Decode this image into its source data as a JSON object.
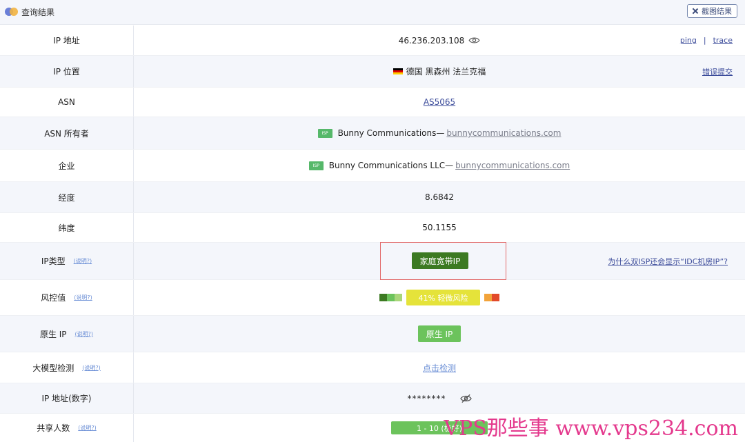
{
  "header": {
    "title": "查询结果",
    "screenshot_button": "截图结果"
  },
  "rows": {
    "ip_address": {
      "label": "IP 地址",
      "value": "46.236.203.108",
      "ping": "ping",
      "separator": "|",
      "trace": "trace"
    },
    "ip_location": {
      "label": "IP 位置",
      "value": "德国 黑森州 法兰克福",
      "flag": "germany-flag",
      "report": "错误提交"
    },
    "asn": {
      "label": "ASN",
      "value": "AS5065"
    },
    "asn_owner": {
      "label": "ASN 所有者",
      "badge": "ISP",
      "name": "Bunny Communications—",
      "domain": "bunnycommunications.com"
    },
    "company": {
      "label": "企业",
      "badge": "ISP",
      "name": "Bunny Communications LLC—",
      "domain": "bunnycommunications.com"
    },
    "longitude": {
      "label": "经度",
      "value": "8.6842"
    },
    "latitude": {
      "label": "纬度",
      "value": "50.1155"
    },
    "ip_type": {
      "label": "IP类型",
      "help": "(说明?)",
      "value": "家庭宽带IP",
      "right_link": "为什么双ISP还会显示“IDC机房IP”?"
    },
    "risk": {
      "label": "风控值",
      "help": "(说明?)",
      "value": "41%  轻微风险",
      "colors": [
        "#3c7a22",
        "#6cc35c",
        "#a9d67a",
        "#e5e33a",
        "#f2a33a",
        "#e24a2a"
      ]
    },
    "native_ip": {
      "label": "原生 IP",
      "help": "(说明?)",
      "value": "原生 IP"
    },
    "llm_check": {
      "label": "大模型检测",
      "help": "(说明?)",
      "value": "点击检测"
    },
    "ip_numeric": {
      "label": "IP 地址(数字)",
      "value": "********"
    },
    "share_count": {
      "label": "共享人数",
      "help": "(说明?)",
      "value": "1 - 10 (极好)"
    }
  },
  "watermark": "VPS那些事 www.vps234.com"
}
